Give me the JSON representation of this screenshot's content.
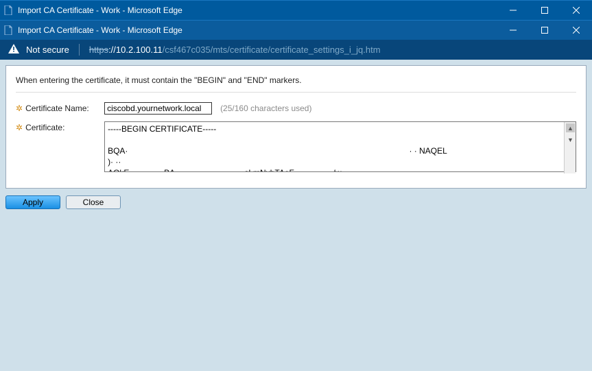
{
  "window": {
    "outer_title": "Import CA Certificate - Work - Microsoft Edge",
    "inner_title": "Import CA Certificate - Work - Microsoft Edge"
  },
  "addressbar": {
    "security_label": "Not secure",
    "url_scheme": "https",
    "url_host": "://10.2.100.11",
    "url_path": "/csf467c035/mts/certificate/certificate_settings_i_jq.htm"
  },
  "form": {
    "hint": "When entering the certificate, it must contain the \"BEGIN\" and \"END\" markers.",
    "cert_name_label": "Certificate Name:",
    "cert_name_value": "ciscobd.yournetwork.local",
    "cert_name_counter": "(25/160 characters used)",
    "cert_label": "Certificate:",
    "cert_value": "-----BEGIN CERTIFICATE-----\n\nBQA·                                                                                                                           · · NAQEL\n)· ··\nAQkE              ·BA-···-          · ·· ···   · sLmNvbTAeF·           ····/w"
  },
  "buttons": {
    "apply": "Apply",
    "close": "Close"
  }
}
